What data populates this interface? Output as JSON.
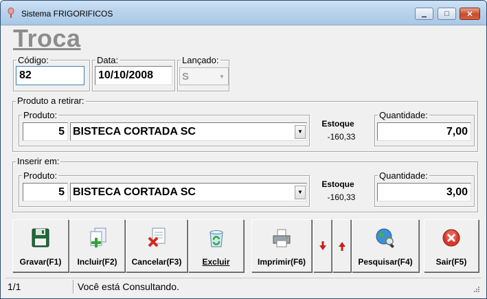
{
  "window": {
    "title": "Sistema FRIGORIFICOS",
    "minimize_glyph": "▁",
    "maximize_glyph": "□",
    "close_glyph": "✕"
  },
  "form": {
    "title": "Troca",
    "codigo": {
      "label": "Código:",
      "value": "82"
    },
    "data": {
      "label": "Data:",
      "value": "10/10/2008"
    },
    "lancado": {
      "label": "Lançado:",
      "value": "S"
    }
  },
  "retirar": {
    "group_label": "Produto a retirar:",
    "produto_label": "Produto:",
    "produto_codigo": "5",
    "produto_nome": "BISTECA CORTADA SC",
    "estoque_label": "Estoque",
    "estoque_value": "-160,33",
    "quantidade_label": "Quantidade:",
    "quantidade_value": "7,00"
  },
  "inserir": {
    "group_label": "Inserir em:",
    "produto_label": "Produto:",
    "produto_codigo": "5",
    "produto_nome": "BISTECA CORTADA SC",
    "estoque_label": "Estoque",
    "estoque_value": "-160,33",
    "quantidade_label": "Quantidade:",
    "quantidade_value": "3,00"
  },
  "toolbar": {
    "gravar": "Gravar(F1)",
    "incluir": "Incluir(F2)",
    "cancelar": "Cancelar(F3)",
    "excluir": "Excluir",
    "imprimir": "Imprimir(F6)",
    "pesquisar": "Pesquisar(F4)",
    "sair": "Sair(F5)",
    "icons": [
      "floppy-save-icon",
      "add-document-icon",
      "cancel-document-icon",
      "recycle-bin-icon",
      "printer-icon",
      "arrow-down-icon",
      "arrow-up-icon",
      "globe-search-icon",
      "exit-icon"
    ]
  },
  "status": {
    "record": "1/1",
    "message": "Você está Consultando."
  },
  "colors": {
    "accent_red": "#c8201a",
    "title_gray": "#8c8c8c",
    "focus_blue": "#3c7fb1"
  }
}
